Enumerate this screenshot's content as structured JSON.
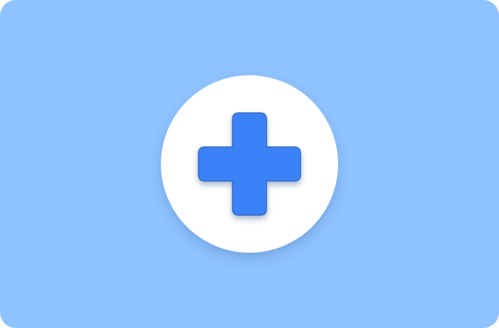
{
  "card": {
    "background": "#8fc3ff"
  },
  "badge": {
    "background": "#ffffff",
    "icon": "plus-icon",
    "icon_color": "#3b82f6",
    "icon_edge_color": "#2f64c6"
  }
}
